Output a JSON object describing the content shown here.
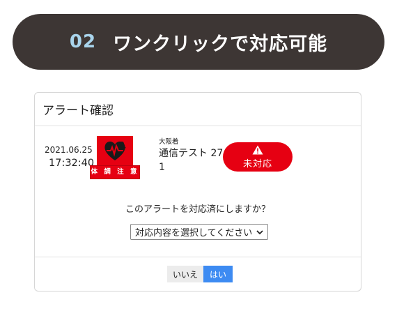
{
  "banner": {
    "number": "02",
    "title": "ワンクリックで対応可能"
  },
  "dialog": {
    "title": "アラート確認",
    "alert": {
      "date": "2021.06.25",
      "time": "17:32:40",
      "badge_label": "体 調 注 意",
      "device_sub": "大阪着",
      "device_name": "通信テスト 271",
      "status_label": "未対応",
      "status_icon": "warning-icon"
    },
    "question": "このアラートを対応済にしますか？",
    "select": {
      "value": "対応内容を選択してください"
    },
    "buttons": {
      "no": "いいえ",
      "yes": "はい"
    }
  },
  "colors": {
    "banner_bg": "#3d3634",
    "banner_number": "#a9d4ec",
    "alert_red": "#e60012",
    "primary_blue": "#3d8bf2"
  }
}
